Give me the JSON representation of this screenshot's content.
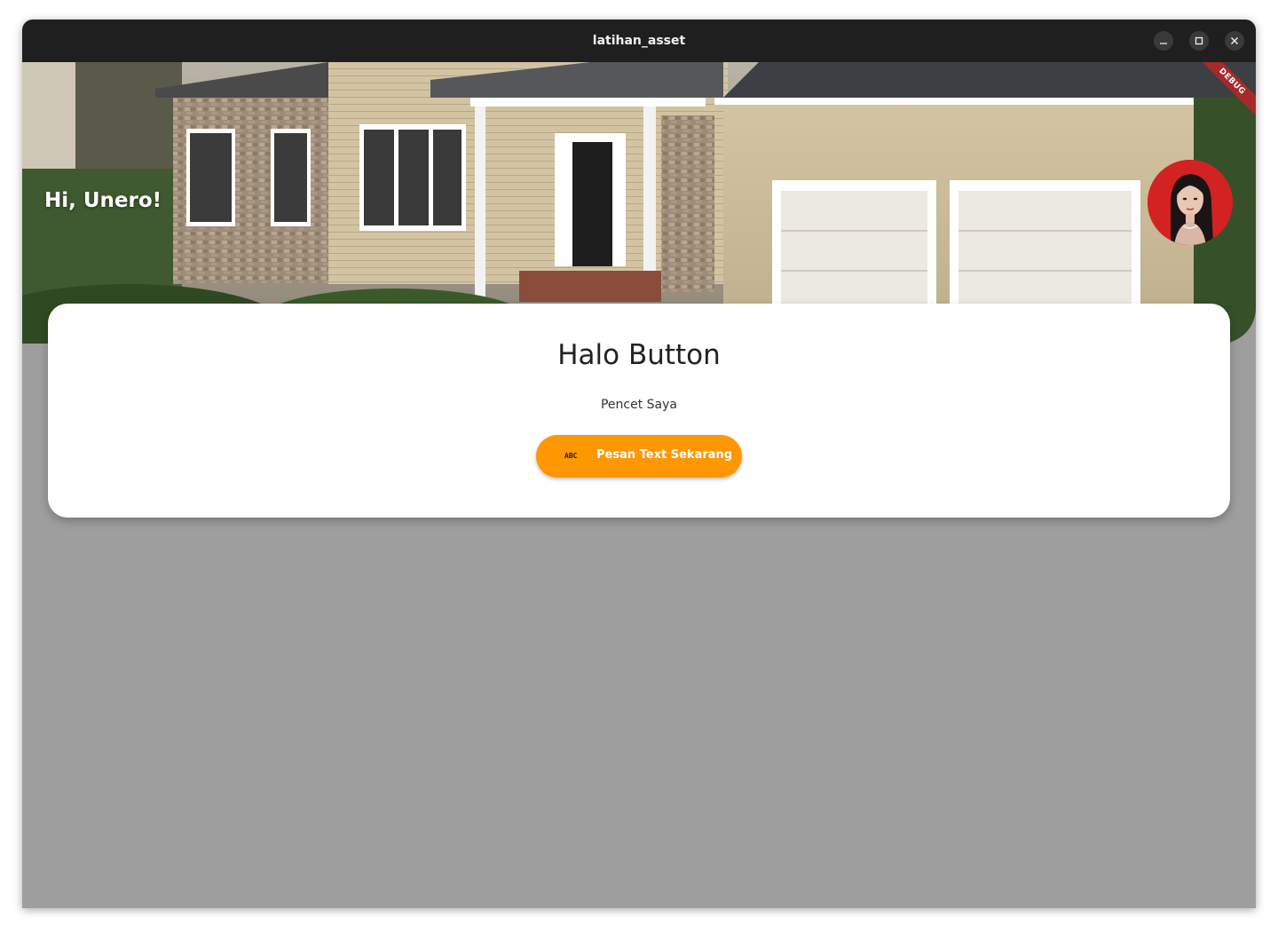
{
  "window": {
    "title": "latihan_asset",
    "controls": [
      "minimize-icon",
      "maximize-icon",
      "close-icon"
    ]
  },
  "header": {
    "greeting": "Hi, Unero!",
    "debug_banner": "DEBUG"
  },
  "card": {
    "title": "Halo Button",
    "subtitle": "Pencet Saya",
    "button": {
      "icon": "abc-icon",
      "icon_text": "ABC",
      "label": "Pesan Text Sekarang"
    }
  },
  "colors": {
    "titlebar": "#1f1f1f",
    "background": "#9e9e9e",
    "card": "#ffffff",
    "button": "#ff9800",
    "debug_ribbon": "#a52a2a",
    "avatar_background": "#d32222"
  }
}
